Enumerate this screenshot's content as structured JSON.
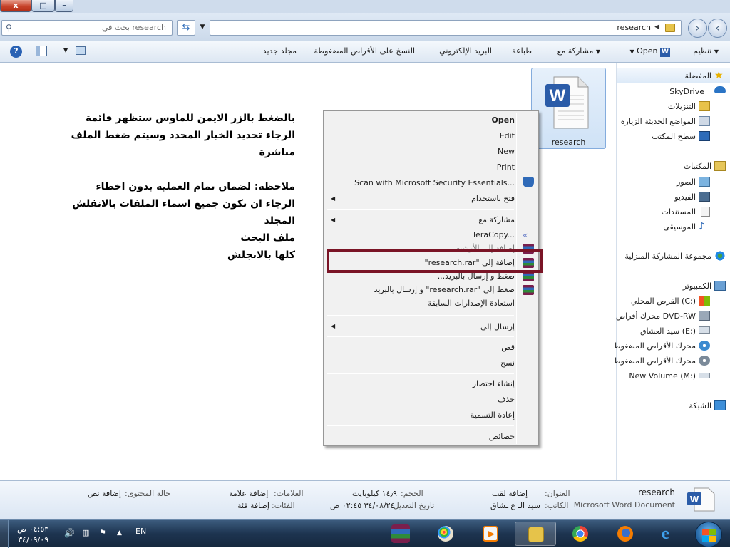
{
  "window": {
    "close_glyph": "x",
    "max_glyph": "□",
    "min_glyph": "–"
  },
  "address": {
    "search_placeholder": "بحث في research",
    "path": "research"
  },
  "toolbar": {
    "organize": "تنظيم",
    "open": "Open",
    "share_with": "مشاركة مع",
    "print": "طباعة",
    "email": "البريد الإلكتروني",
    "burn": "النسخ على الأقراص المضغوطة",
    "new_folder": "مجلد جديد"
  },
  "nav": {
    "favorites": "المفضلة",
    "skydrive": "SkyDrive",
    "downloads": "التنزيلات",
    "recent_places": "المواضع الحديثة الزيارة",
    "desktop": "سطح المكتب",
    "libraries": "المكتبات",
    "pictures": "الصور",
    "videos": "الفيديو",
    "documents": "المستندات",
    "music": "الموسيقى",
    "homegroup": "مجموعة المشاركة المنزلية",
    "computer": "الكمبيوتر",
    "local_disk": "القرص المحلي (C:)",
    "dvd_rw": "محرك أقراص DVD-RW",
    "drive_e": "سيد العشاق (E:)",
    "cd_drive_1": "محرك الأقراص المضغوط",
    "cd_drive_2": "محرك الأقراص المضغوط",
    "new_volume": "New Volume (M:)",
    "network": "الشبكة"
  },
  "file": {
    "name": "research"
  },
  "instructions": "بالضغط بالزر الايمن للماوس ستظهر قائمة\nالرجاء تحديد الخيار المحدد وسيتم ضغط الملف\nمباشرة\n\nملاحظة: لضمان تمام العملية بدون اخطاء\nالرجاء ان تكون جميع اسماء الملفات بالانقلش\nالمجلد\nملف البحث\nكلها بالانجلش",
  "context_menu": {
    "open": "Open",
    "edit": "Edit",
    "new": "New",
    "print": "Print",
    "scan": "Scan with Microsoft Security Essentials...",
    "open_with": "فتح باستخدام",
    "share_with": "مشاركة مع",
    "teracopy": "TeraCopy...",
    "add_to_archive": "إضافة إلى الأرشيف...",
    "add_to_rar": "إضافة إلى \"research.rar\"",
    "compress_email": "ضغط و إرسال بالبريد...",
    "compress_rar_email": "ضغط إلى \"research.rar\" و إرسال بالبريد",
    "restore_versions": "استعادة الإصدارات السابقة",
    "send_to": "إرسال إلى",
    "cut": "قص",
    "copy": "نسخ",
    "create_shortcut": "إنشاء اختصار",
    "delete": "حذف",
    "rename": "إعادة التسمية",
    "properties": "خصائص"
  },
  "details": {
    "filename": "research",
    "filetype": "Microsoft Word Document",
    "title_label": "العنوان:",
    "title_value": "إضافة لقب",
    "author_label": "الكاتب:",
    "author_value": "سيد الـ ع ـشاق",
    "size_label": "الحجم:",
    "size_value": "١٤٫٩ كيلوبايت",
    "modified_label": "تاريخ التعديل:",
    "modified_value": "٣٤/٠٨/٢٤ ٠٢:٤٥ ص",
    "tags_label": "العلامات:",
    "tags_value": "إضافة علامة",
    "categories_label": "الفئات:",
    "categories_value": "إضافة فئة",
    "content_status_label": "حالة المحتوى:",
    "content_status_value": "إضافة نص"
  },
  "taskbar": {
    "time": "٠٤:٥٣ ص",
    "date": "٣٤/٠٩/٠٩",
    "language": "EN"
  },
  "colors": {
    "highlight_border": "#7a1426",
    "accent": "#2f6ab8"
  }
}
